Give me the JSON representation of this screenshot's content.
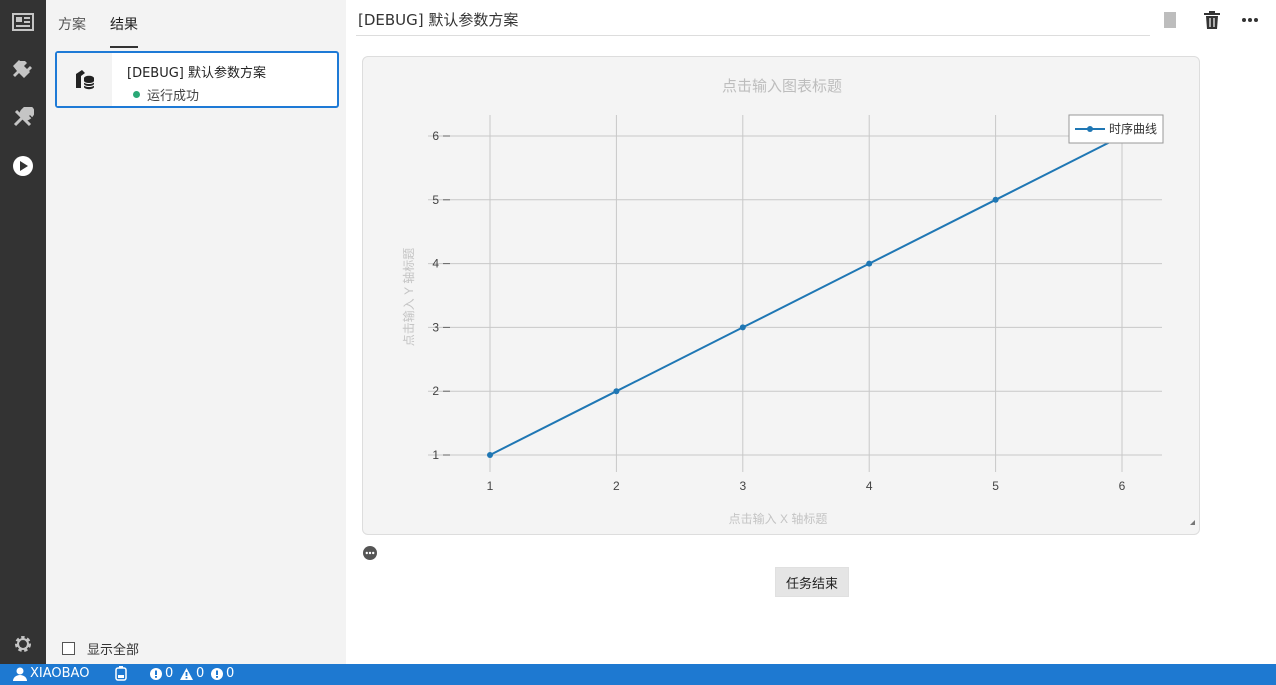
{
  "activity_bar": {
    "items": [
      {
        "icon": "dashboard-icon"
      },
      {
        "icon": "plugin-icon"
      },
      {
        "icon": "tools-icon"
      },
      {
        "icon": "run-icon"
      }
    ],
    "settings_icon": "gear-icon"
  },
  "side_panel": {
    "tabs": [
      {
        "label": "方案",
        "active": false
      },
      {
        "label": "结果",
        "active": true
      }
    ],
    "results": [
      {
        "title": "[DEBUG] 默认参数方案",
        "status": "运行成功",
        "status_color": "#2aa876",
        "icon": "task-database-icon"
      }
    ],
    "show_all_label": "显示全部",
    "show_all_checked": false
  },
  "main": {
    "title": "[DEBUG] 默认参数方案",
    "toolbar": {
      "stop_icon": "stop-icon",
      "delete_icon": "trash-icon",
      "more_icon": "more-horizontal-icon"
    },
    "end_button_label": "任务结束",
    "more_options_icon": "more-circle-icon"
  },
  "chart_data": {
    "type": "line",
    "title": "点击输入图表标题",
    "xlabel": "点击输入 X 轴标题",
    "ylabel": "点击输入 Y 轴标题",
    "x": [
      1,
      2,
      3,
      4,
      5,
      6
    ],
    "series": [
      {
        "name": "时序曲线",
        "values": [
          1,
          2,
          3,
          4,
          5,
          6
        ],
        "color": "#1f77b4"
      }
    ],
    "xlim": [
      1,
      6
    ],
    "ylim": [
      1,
      6
    ],
    "xticks": [
      "1",
      "2",
      "3",
      "4",
      "5",
      "6"
    ],
    "yticks": [
      "1",
      "2",
      "3",
      "4",
      "5",
      "6"
    ],
    "grid": true,
    "legend_position": "top-right"
  },
  "status_bar": {
    "user": "XIAOBAO",
    "errors": "0",
    "warnings": "0",
    "infos": "0",
    "background": "#1e79d1"
  }
}
